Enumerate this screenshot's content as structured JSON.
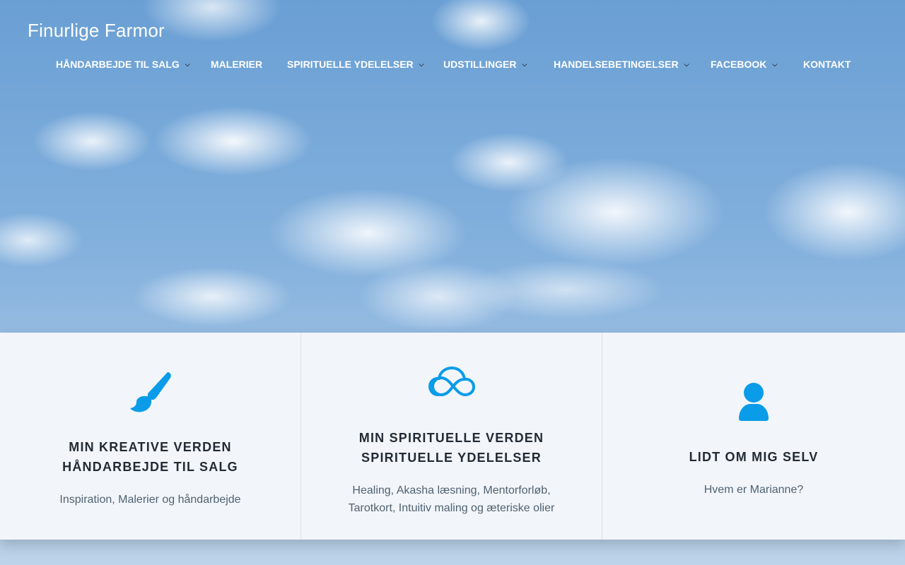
{
  "site": {
    "title": "Finurlige Farmor"
  },
  "nav": {
    "items": [
      {
        "label": "HÅNDARBEJDE TIL SALG",
        "has_dropdown": true
      },
      {
        "label": "MALERIER",
        "has_dropdown": false
      },
      {
        "label": "SPIRITUELLE YDELELSER",
        "has_dropdown": true
      },
      {
        "label": "UDSTILLINGER",
        "has_dropdown": true
      },
      {
        "label": "HANDELSEBETINGELSER",
        "has_dropdown": true
      },
      {
        "label": "FACEBOOK",
        "has_dropdown": true
      },
      {
        "label": "KONTAKT",
        "has_dropdown": false
      }
    ],
    "dropdown_icon": "chevron-down-icon"
  },
  "hero": {
    "background": "sky-with-clouds"
  },
  "cards": [
    {
      "icon": "paintbrush-icon",
      "title_lines": [
        "MIN KREATIVE VERDEN",
        "HÅNDARBEJDE TIL SALG"
      ],
      "description_lines": [
        "Inspiration, Malerier og håndarbejde"
      ]
    },
    {
      "icon": "cloud-icon",
      "title_lines": [
        "MIN SPIRITUELLE VERDEN",
        "SPIRITUELLE YDELELSER"
      ],
      "description_lines": [
        "Healing, Akasha læsning, Mentorforløb,",
        "Tarotkort, Intuitiv maling og æteriske olier"
      ]
    },
    {
      "icon": "user-icon",
      "title_lines": [
        "LIDT OM MIG SELV"
      ],
      "description_lines": [
        "Hvem er Marianne?"
      ]
    }
  ],
  "colors": {
    "accent": "#0a9ce8",
    "card_bg": "#f2f5f9",
    "title": "#222b35",
    "description": "#4f6272"
  }
}
